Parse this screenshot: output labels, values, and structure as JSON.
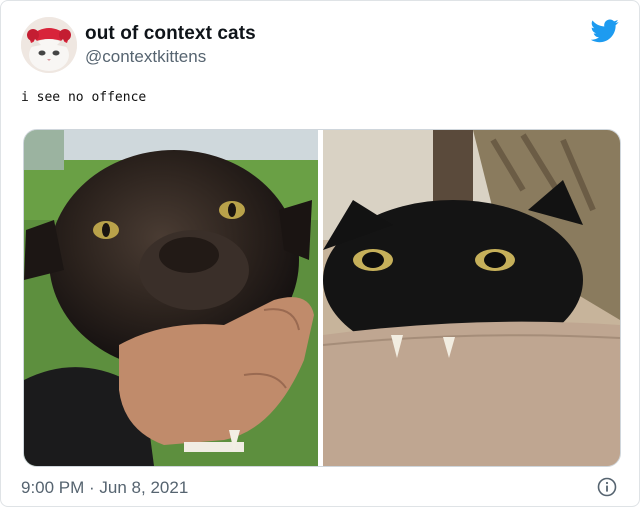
{
  "author": {
    "display_name": "out of context cats",
    "handle": "@contextkittens",
    "avatar_icon": "cat-avatar-icon"
  },
  "brand": {
    "icon": "twitter-bird-icon",
    "color": "#1d9bf0"
  },
  "tweet": {
    "text": "i see no offence",
    "media": [
      {
        "label": "panther-biting-hand-photo"
      },
      {
        "label": "black-cat-biting-arm-photo"
      }
    ]
  },
  "footer": {
    "time": "9:00 PM",
    "separator": "·",
    "date": "Jun 8, 2021",
    "timestamp": "9:00 PM · Jun 8, 2021",
    "info_icon": "info-icon"
  },
  "colors": {
    "secondary_text": "#566470",
    "border": "#dfe3e6"
  }
}
